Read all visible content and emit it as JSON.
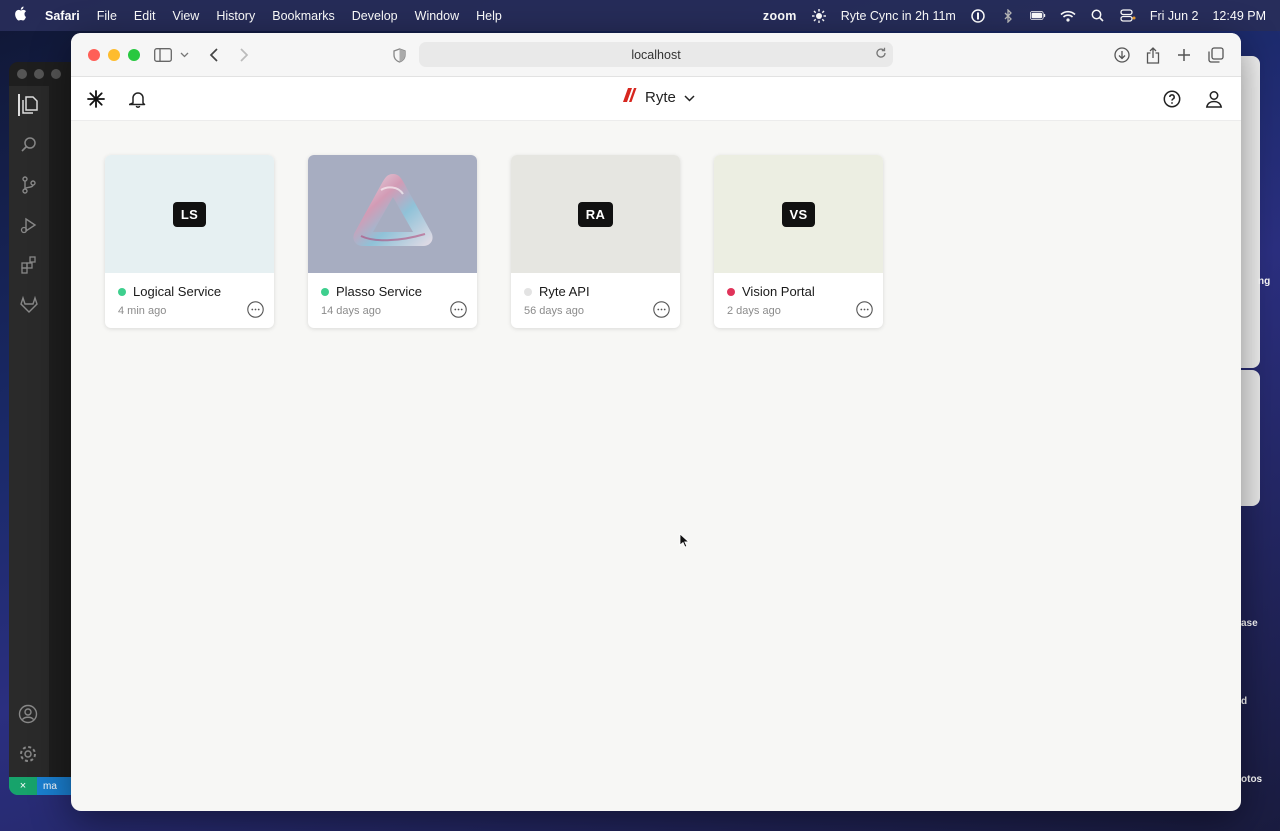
{
  "menubar": {
    "app": "Safari",
    "items": [
      "File",
      "Edit",
      "View",
      "History",
      "Bookmarks",
      "Develop",
      "Window",
      "Help"
    ],
    "zoom": "zoom",
    "status": "Ryte Cync in 2h 11m",
    "date": "Fri Jun 2",
    "time": "12:49 PM"
  },
  "browser": {
    "url": "localhost"
  },
  "app": {
    "brand": "Ryte",
    "brand_color": "#d7261e"
  },
  "projects": [
    {
      "initials": "LS",
      "name": "Logical Service",
      "time": "4 min ago",
      "status_color": "#3ecf8e",
      "thumb_color": "#e6f0f2"
    },
    {
      "initials": "",
      "name": "Plasso Service",
      "time": "14 days ago",
      "status_color": "#3ecf8e",
      "thumb_color": "#a7adc1"
    },
    {
      "initials": "RA",
      "name": "Ryte API",
      "time": "56 days ago",
      "status_color": "#e3e3e3",
      "thumb_color": "#e6e6e1"
    },
    {
      "initials": "VS",
      "name": "Vision Portal",
      "time": "2 days ago",
      "status_color": "#e0345a",
      "thumb_color": "#eceee2"
    }
  ],
  "background": {
    "side_labels": [
      "ng",
      "ase",
      "d",
      "otos"
    ],
    "vscode_branch": "ma"
  }
}
